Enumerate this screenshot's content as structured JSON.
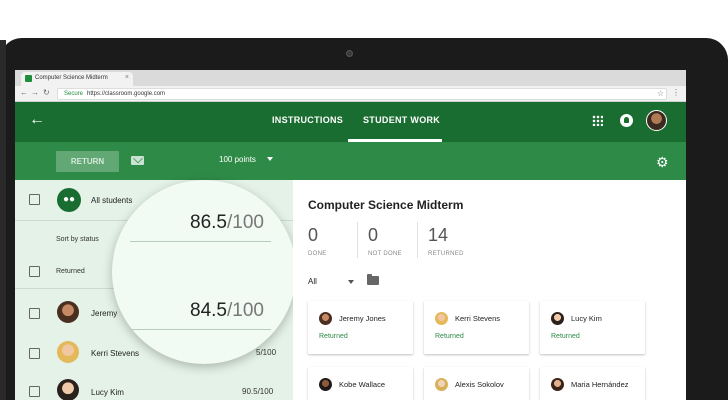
{
  "browser": {
    "tab_title": "Computer Science Midterm",
    "secure_label": "Secure",
    "url": "https://classroom.google.com"
  },
  "appbar": {
    "tabs": [
      {
        "label": "INSTRUCTIONS"
      },
      {
        "label": "STUDENT WORK",
        "active": true
      }
    ]
  },
  "toolbar": {
    "return_label": "RETURN",
    "points_label": "100 points"
  },
  "left_panel": {
    "all_students_label": "All students",
    "sort_label": "Sort by status",
    "returned_label": "Returned",
    "students": [
      {
        "name": "Jeremy",
        "grade": ""
      },
      {
        "name": "Kerri Stevens",
        "grade": "5/100"
      },
      {
        "name": "Lucy Kim",
        "grade": "90.5/100"
      }
    ]
  },
  "magnifier": {
    "scores": [
      {
        "value": "86.5",
        "denominator": "/100"
      },
      {
        "value": "84.5",
        "denominator": "/100"
      }
    ]
  },
  "assignment": {
    "title": "Computer Science Midterm",
    "stats": [
      {
        "count": "0",
        "label": "DONE"
      },
      {
        "count": "0",
        "label": "NOT DONE"
      },
      {
        "count": "14",
        "label": "RETURNED"
      }
    ],
    "filter_label": "All"
  },
  "cards": [
    {
      "name": "Jeremy Jones",
      "status": "Returned"
    },
    {
      "name": "Kerri Stevens",
      "status": "Returned"
    },
    {
      "name": "Lucy Kim",
      "status": "Returned"
    },
    {
      "name": "Kobe Wallace",
      "status": ""
    },
    {
      "name": "Alexis Sokolov",
      "status": ""
    },
    {
      "name": "Maria Hernández",
      "status": ""
    }
  ],
  "colors": {
    "appbar": "#1a6d31",
    "toolbar": "#2e8b47",
    "left_panel": "#e4f2e7",
    "accent_text": "#2e8b47"
  },
  "icons": [
    "back-arrow-icon",
    "apps-grid-icon",
    "notification-icon",
    "mail-icon",
    "dropdown-caret-icon",
    "settings-gear-icon",
    "group-icon",
    "folder-icon"
  ]
}
